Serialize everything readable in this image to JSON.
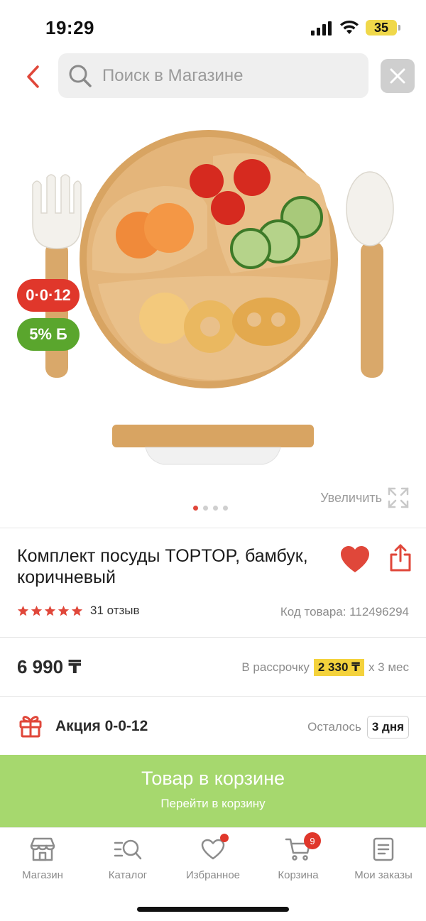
{
  "status_bar": {
    "time": "19:29",
    "battery": "35"
  },
  "header": {
    "search_placeholder": "Поиск в Магазине",
    "icons": [
      "chevron-left-icon",
      "search-icon",
      "close-icon"
    ]
  },
  "gallery": {
    "badge_installment": "0·0·12",
    "badge_bonus": "5%",
    "badge_bonus_symbol": "Б",
    "zoom_label": "Увеличить",
    "slides_count": 4,
    "active_slide": 1
  },
  "product": {
    "title": "Комплект посуды TOPTOP, бамбук, коричневый",
    "rating": 5,
    "reviews": "31 отзыв",
    "code": "Код товара: 112496294",
    "price": "6 990 ₸",
    "installment_prefix": "В рассрочку",
    "installment_amount": "2 330 ₸",
    "installment_suffix": "x 3 мес"
  },
  "promo": {
    "label": "Акция 0-0-12",
    "remaining_label": "Осталось",
    "remaining_days": "3 дня"
  },
  "cart_cta": {
    "title": "Товар в корзине",
    "subtitle": "Перейти в корзину"
  },
  "tabs": [
    {
      "label": "Магазин",
      "icon": "store-icon"
    },
    {
      "label": "Каталог",
      "icon": "catalog-search-icon"
    },
    {
      "label": "Избранное",
      "icon": "heart-outline-icon"
    },
    {
      "label": "Корзина",
      "icon": "cart-icon",
      "badge": "9"
    },
    {
      "label": "Мои заказы",
      "icon": "orders-list-icon"
    }
  ],
  "colors": {
    "accent_red": "#e0372b",
    "bonus_green": "#5aa62d",
    "cta_green": "#a6d86e",
    "installment_yellow": "#f4d23c"
  }
}
